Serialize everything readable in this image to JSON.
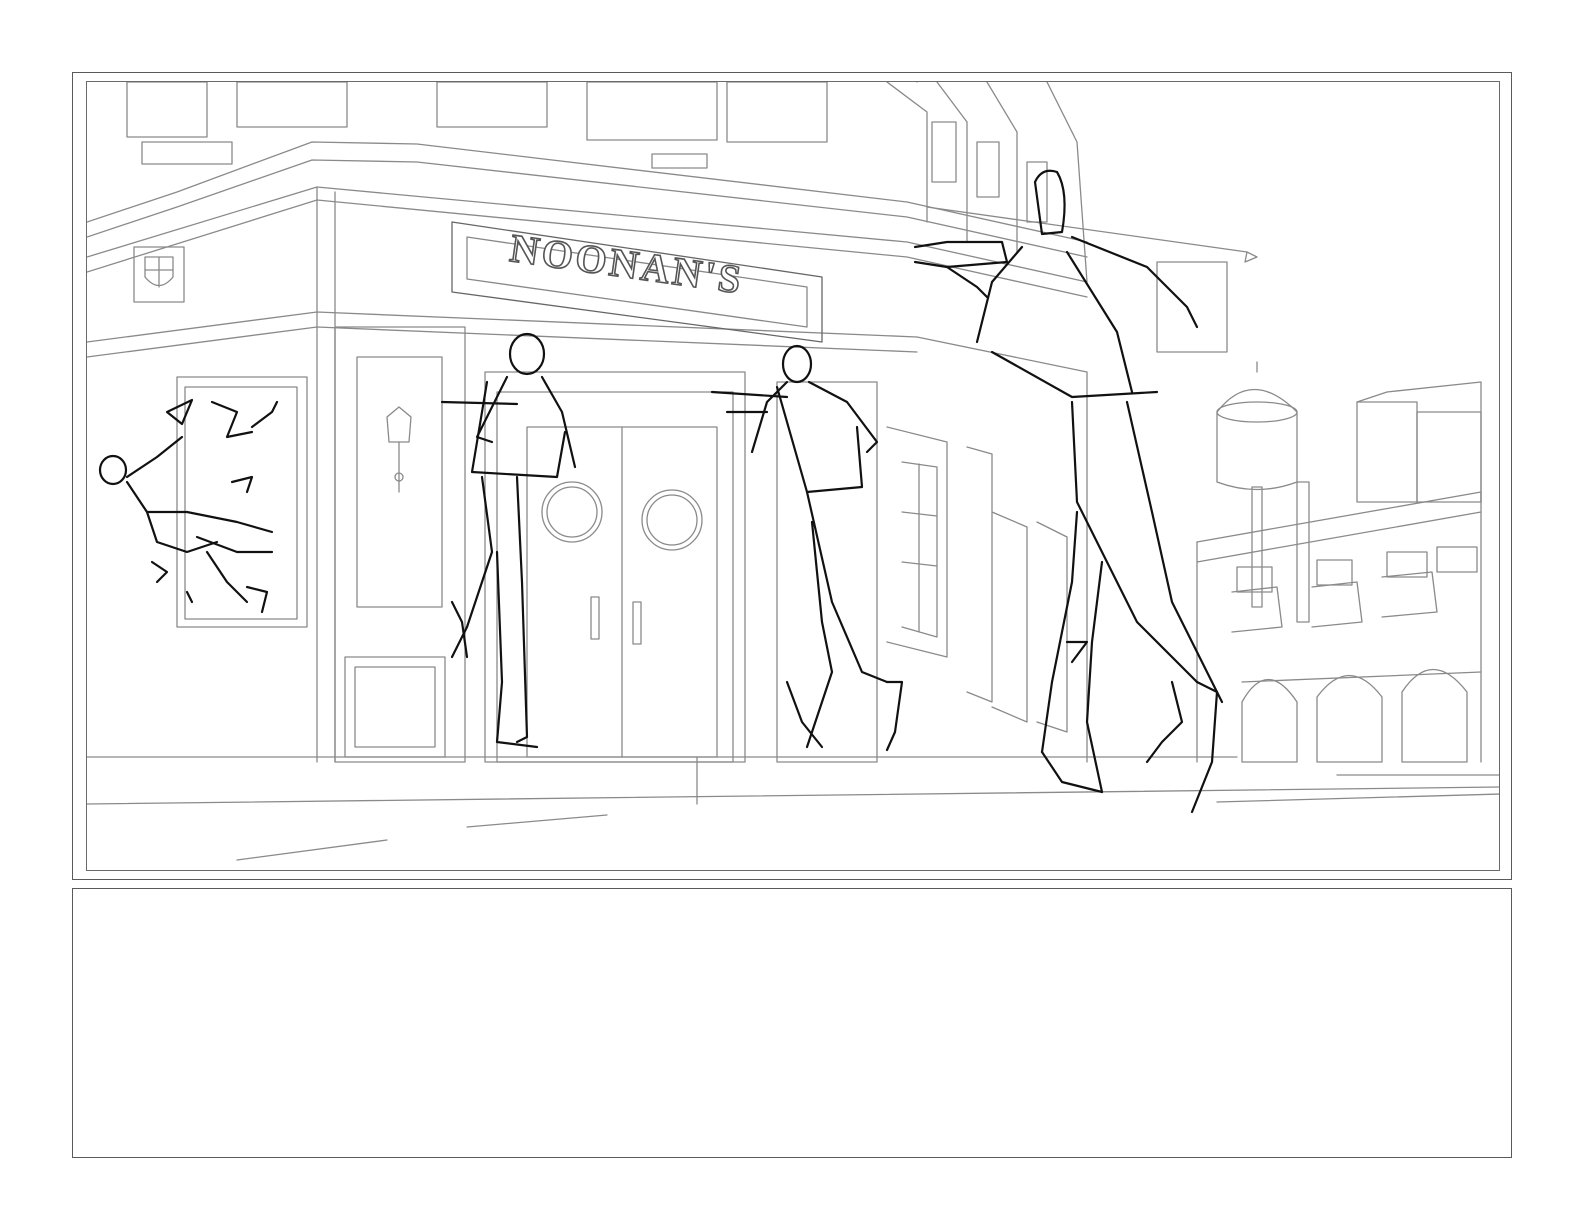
{
  "storyboard": {
    "panel": {
      "sign_text": "NOONAN'S"
    },
    "notes": {
      "text": ""
    }
  }
}
